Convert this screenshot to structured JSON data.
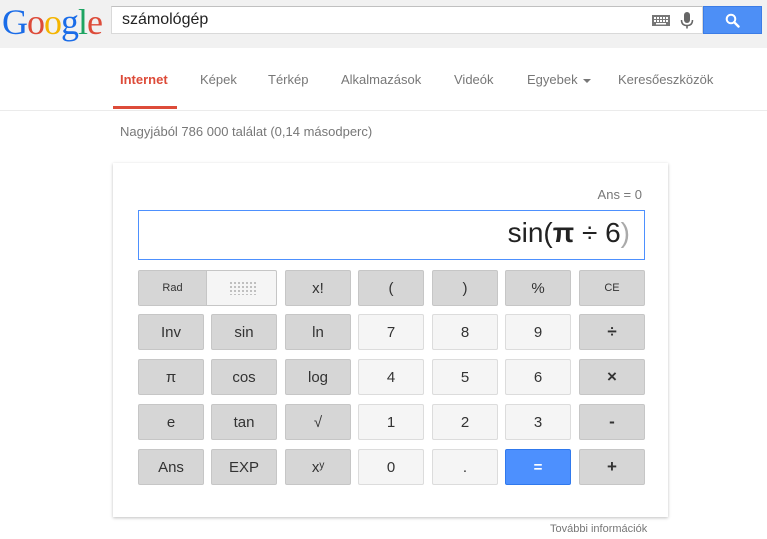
{
  "logo": {
    "letters": [
      "G",
      "o",
      "o",
      "g",
      "l",
      "e"
    ],
    "colors": [
      "#1a6ce8",
      "#dd4b39",
      "#f4b400",
      "#1a6ce8",
      "#1da462",
      "#dd4b39"
    ]
  },
  "search": {
    "query": "számológép",
    "icons": [
      "keyboard-icon",
      "microphone-icon",
      "search-icon"
    ]
  },
  "tabs": [
    {
      "label": "Internet",
      "active": true
    },
    {
      "label": "Képek"
    },
    {
      "label": "Térkép"
    },
    {
      "label": "Alkalmazások"
    },
    {
      "label": "Videók"
    },
    {
      "label": "Egyebek"
    },
    {
      "label": "Keresőeszközök"
    }
  ],
  "result_stats": "Nagyjából 786 000 találat (0,14 másodperc)",
  "calculator": {
    "ans_line": "Ans = 0",
    "expr_func": "sin(",
    "expr_pi": "π",
    "expr_rest": " ÷ 6",
    "expr_close": ")",
    "mode_label": "Rad",
    "keys": {
      "fact": "x!",
      "lparen": "(",
      "rparen": ")",
      "percent": "%",
      "ce": "CE",
      "inv": "Inv",
      "sin": "sin",
      "ln": "ln",
      "k7": "7",
      "k8": "8",
      "k9": "9",
      "div": "÷",
      "pi": "π",
      "cos": "cos",
      "log": "log",
      "k4": "4",
      "k5": "5",
      "k6": "6",
      "mul": "×",
      "e": "e",
      "tan": "tan",
      "sqrt": "√",
      "k1": "1",
      "k2": "2",
      "k3": "3",
      "minus": "-",
      "ans": "Ans",
      "exp": "EXP",
      "pow": "xʸ",
      "k0": "0",
      "dot": ".",
      "eq": "=",
      "plus": "+"
    },
    "more_info": "További információk"
  },
  "colors": {
    "accent": "#dd4b39",
    "blue": "#4d90fe"
  }
}
